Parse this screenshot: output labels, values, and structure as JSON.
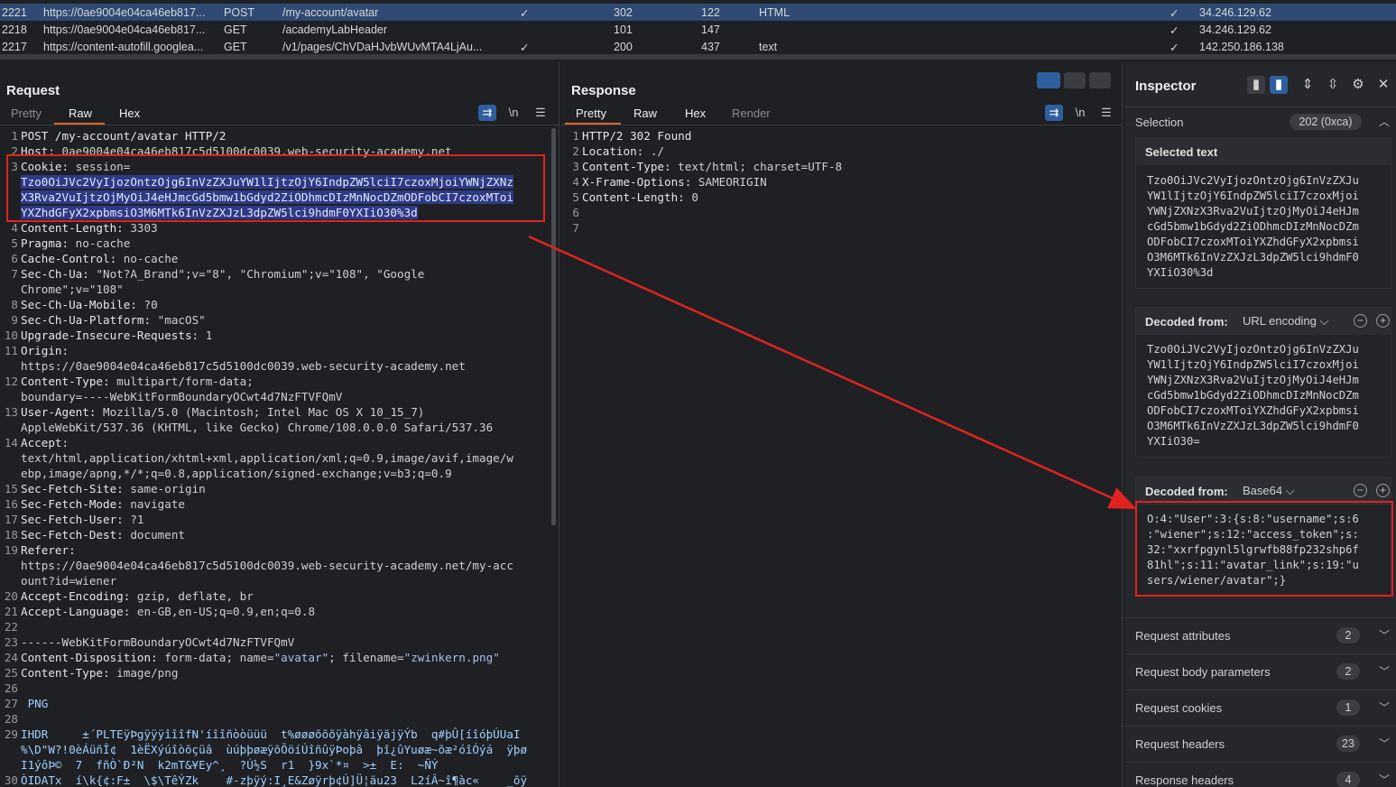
{
  "history": {
    "rows": [
      {
        "id": "2221",
        "url": "https://0ae9004e04ca46eb817...",
        "method": "POST",
        "path": "/my-account/avatar",
        "edited": "✓",
        "status": "302",
        "length": "122",
        "mime": "HTML",
        "tls": "✓",
        "ip": "34.246.129.62"
      },
      {
        "id": "2218",
        "url": "https://0ae9004e04ca46eb817...",
        "method": "GET",
        "path": "/academyLabHeader",
        "edited": "",
        "status": "101",
        "length": "147",
        "mime": "",
        "tls": "✓",
        "ip": "34.246.129.62"
      },
      {
        "id": "2217",
        "url": "https://content-autofill.googlea...",
        "method": "GET",
        "path": "/v1/pages/ChVDaHJvbWUvMTA4LjAu...",
        "edited": "✓",
        "status": "200",
        "length": "437",
        "mime": "text",
        "tls": "✓",
        "ip": "142.250.186.138"
      }
    ]
  },
  "request": {
    "title": "Request",
    "tabs": [
      "Pretty",
      "Raw",
      "Hex"
    ],
    "active_tab": "Raw",
    "tool_newline": "\\n",
    "lines": [
      {
        "n": "1",
        "segs": [
          {
            "t": "POST /my-account/avatar HTTP/2",
            "c": "k"
          }
        ]
      },
      {
        "n": "2",
        "segs": [
          {
            "t": "Host: ",
            "c": "k"
          },
          {
            "t": "0ae9004e04ca46eb817c5d5100dc0039.web-security-academy.net",
            "c": "v"
          }
        ]
      },
      {
        "n": "3",
        "segs": [
          {
            "t": "Cookie: ",
            "c": "k"
          },
          {
            "t": "session=",
            "c": "v"
          }
        ]
      },
      {
        "n": "",
        "segs": [
          {
            "t": "Tzo0OiJVc2VyIjozOntzOjg6InVzZXJuYW1lIjtzOjY6IndpZW5lciI7czoxMjoiYWNjZXNz",
            "c": "hl"
          }
        ]
      },
      {
        "n": "",
        "segs": [
          {
            "t": "X3Rva2VuIjtzOjMyOiJ4eHJmcGd5bmw1bGdyd2ZiODhmcDIzMnNocDZmODFobCI7czoxMToi",
            "c": "hl"
          }
        ]
      },
      {
        "n": "",
        "segs": [
          {
            "t": "YXZhdGFyX2xpbmsiO3M6MTk6InVzZXJzL3dpZW5lci9hdmF0YXIiO30%3d",
            "c": "hl"
          }
        ]
      },
      {
        "n": "4",
        "segs": [
          {
            "t": "Content-Length: ",
            "c": "k"
          },
          {
            "t": "3303",
            "c": "v"
          }
        ]
      },
      {
        "n": "5",
        "segs": [
          {
            "t": "Pragma: ",
            "c": "k"
          },
          {
            "t": "no-cache",
            "c": "v"
          }
        ]
      },
      {
        "n": "6",
        "segs": [
          {
            "t": "Cache-Control: ",
            "c": "k"
          },
          {
            "t": "no-cache",
            "c": "v"
          }
        ]
      },
      {
        "n": "7",
        "segs": [
          {
            "t": "Sec-Ch-Ua: ",
            "c": "k"
          },
          {
            "t": "\"Not?A_Brand\";v=\"8\", \"Chromium\";v=\"108\", \"Google",
            "c": "v"
          }
        ]
      },
      {
        "n": "",
        "segs": [
          {
            "t": "Chrome\";v=\"108\"",
            "c": "v"
          }
        ]
      },
      {
        "n": "8",
        "segs": [
          {
            "t": "Sec-Ch-Ua-Mobile: ",
            "c": "k"
          },
          {
            "t": "?0",
            "c": "v"
          }
        ]
      },
      {
        "n": "9",
        "segs": [
          {
            "t": "Sec-Ch-Ua-Platform: ",
            "c": "k"
          },
          {
            "t": "\"macOS\"",
            "c": "v"
          }
        ]
      },
      {
        "n": "10",
        "segs": [
          {
            "t": "Upgrade-Insecure-Requests: ",
            "c": "k"
          },
          {
            "t": "1",
            "c": "v"
          }
        ]
      },
      {
        "n": "11",
        "segs": [
          {
            "t": "Origin: ",
            "c": "k"
          }
        ]
      },
      {
        "n": "",
        "segs": [
          {
            "t": "https://0ae9004e04ca46eb817c5d5100dc0039.web-security-academy.net",
            "c": "v"
          }
        ]
      },
      {
        "n": "12",
        "segs": [
          {
            "t": "Content-Type: ",
            "c": "k"
          },
          {
            "t": "multipart/form-data;",
            "c": "v"
          }
        ]
      },
      {
        "n": "",
        "segs": [
          {
            "t": "boundary=----WebKitFormBoundaryOCwt4d7NzFTVFQmV",
            "c": "v"
          }
        ]
      },
      {
        "n": "13",
        "segs": [
          {
            "t": "User-Agent: ",
            "c": "k"
          },
          {
            "t": "Mozilla/5.0 (Macintosh; Intel Mac OS X 10_15_7)",
            "c": "v"
          }
        ]
      },
      {
        "n": "",
        "segs": [
          {
            "t": "AppleWebKit/537.36 (KHTML, like Gecko) Chrome/108.0.0.0 Safari/537.36",
            "c": "v"
          }
        ]
      },
      {
        "n": "14",
        "segs": [
          {
            "t": "Accept: ",
            "c": "k"
          }
        ]
      },
      {
        "n": "",
        "segs": [
          {
            "t": "text/html,application/xhtml+xml,application/xml;q=0.9,image/avif,image/w",
            "c": "v"
          }
        ]
      },
      {
        "n": "",
        "segs": [
          {
            "t": "ebp,image/apng,*/*;q=0.8,application/signed-exchange;v=b3;q=0.9",
            "c": "v"
          }
        ]
      },
      {
        "n": "15",
        "segs": [
          {
            "t": "Sec-Fetch-Site: ",
            "c": "k"
          },
          {
            "t": "same-origin",
            "c": "v"
          }
        ]
      },
      {
        "n": "16",
        "segs": [
          {
            "t": "Sec-Fetch-Mode: ",
            "c": "k"
          },
          {
            "t": "navigate",
            "c": "v"
          }
        ]
      },
      {
        "n": "17",
        "segs": [
          {
            "t": "Sec-Fetch-User: ",
            "c": "k"
          },
          {
            "t": "?1",
            "c": "v"
          }
        ]
      },
      {
        "n": "18",
        "segs": [
          {
            "t": "Sec-Fetch-Dest: ",
            "c": "k"
          },
          {
            "t": "document",
            "c": "v"
          }
        ]
      },
      {
        "n": "19",
        "segs": [
          {
            "t": "Referer: ",
            "c": "k"
          }
        ]
      },
      {
        "n": "",
        "segs": [
          {
            "t": "https://0ae9004e04ca46eb817c5d5100dc0039.web-security-academy.net/my-acc",
            "c": "v"
          }
        ]
      },
      {
        "n": "",
        "segs": [
          {
            "t": "ount?id=wiener",
            "c": "v"
          }
        ]
      },
      {
        "n": "20",
        "segs": [
          {
            "t": "Accept-Encoding: ",
            "c": "k"
          },
          {
            "t": "gzip, deflate, br",
            "c": "v"
          }
        ]
      },
      {
        "n": "21",
        "segs": [
          {
            "t": "Accept-Language: ",
            "c": "k"
          },
          {
            "t": "en-GB,en-US;q=0.9,en;q=0.8",
            "c": "v"
          }
        ]
      },
      {
        "n": "22",
        "segs": []
      },
      {
        "n": "23",
        "segs": [
          {
            "t": "------WebKitFormBoundaryOCwt4d7NzFTVFQmV",
            "c": "v"
          }
        ]
      },
      {
        "n": "24",
        "segs": [
          {
            "t": "Content-Disposition: ",
            "c": "k"
          },
          {
            "t": "form-data; name=",
            "c": "v"
          },
          {
            "t": "\"avatar\"",
            "c": "str"
          },
          {
            "t": "; filename=",
            "c": "v"
          },
          {
            "t": "\"zwinkern.png\"",
            "c": "str"
          }
        ]
      },
      {
        "n": "25",
        "segs": [
          {
            "t": "Content-Type: ",
            "c": "k"
          },
          {
            "t": "image/png",
            "c": "v"
          }
        ]
      },
      {
        "n": "26",
        "segs": []
      },
      {
        "n": "27",
        "segs": [
          {
            "t": " PNG",
            "c": "bin"
          }
        ]
      },
      {
        "n": "28",
        "segs": []
      },
      {
        "n": "29",
        "segs": [
          {
            "t": "IHDR     ±´PLTEÿÞgÿÿÿîîîfN'íîîñòòüüü  t%øøøõõõÿàhÿâiÿäjÿÝb  q#þÛ[íîóþÚUaI",
            "c": "bin"
          }
        ]
      },
      {
        "n": "",
        "segs": [
          {
            "t": "%\\D\"W?!0èÁüñÎ¢  1èËXýúîòõçüâ  ùúþþøæÿõÕöíÚîñûÿÞoþâ  þî¿ûYuøæ~õæ²óîÓýá  ÿþø",
            "c": "bin"
          }
        ]
      },
      {
        "n": "",
        "segs": [
          {
            "t": "I1ýôÞ©  7  fñÒ`Ð²N  k2mT&¥Ey^¸  ?Ú½S  r1  }9x`*¤  >±  E:  ~ÑÝ",
            "c": "bin"
          }
        ]
      },
      {
        "n": "30",
        "segs": [
          {
            "t": "ÒIDATx  í\\k{¢:F±  \\$\\TêÝZk    #-zþÿý:I¸E&Zøÿrþ¢Ú]Ü¦äu23  L2íÂ~î¶àc«    _õÿ",
            "c": "bin"
          }
        ]
      }
    ]
  },
  "response": {
    "title": "Response",
    "tabs": [
      "Pretty",
      "Raw",
      "Hex",
      "Render"
    ],
    "active_tab": "Pretty",
    "tool_newline": "\\n",
    "lines": [
      {
        "n": "1",
        "segs": [
          {
            "t": "HTTP/2 302 Found",
            "c": "k"
          }
        ]
      },
      {
        "n": "2",
        "segs": [
          {
            "t": "Location: ",
            "c": "k"
          },
          {
            "t": "./",
            "c": "v"
          }
        ]
      },
      {
        "n": "3",
        "segs": [
          {
            "t": "Content-Type: ",
            "c": "k"
          },
          {
            "t": "text/html; charset=UTF-8",
            "c": "v"
          }
        ]
      },
      {
        "n": "4",
        "segs": [
          {
            "t": "X-Frame-Options: ",
            "c": "k"
          },
          {
            "t": "SAMEORIGIN",
            "c": "v"
          }
        ]
      },
      {
        "n": "5",
        "segs": [
          {
            "t": "Content-Length: ",
            "c": "k"
          },
          {
            "t": "0",
            "c": "v"
          }
        ]
      },
      {
        "n": "6",
        "segs": []
      },
      {
        "n": "7",
        "segs": []
      }
    ]
  },
  "inspector": {
    "title": "Inspector",
    "selection_label": "Selection",
    "selection_value": "202 (0xca)",
    "selected_text_label": "Selected text",
    "selected_text": "Tzo0OiJVc2VyIjozOntzOjg6InVzZXJu\nYW1lIjtzOjY6IndpZW5lciI7czoxMjoi\nYWNjZXNzX3Rva2VuIjtzOjMyOiJ4eHJm\ncGd5bmw1bGdyd2ZiODhmcDIzMnNocDZm\nODFobCI7czoxMToiYXZhdGFyX2xpbmsi\nO3M6MTk6InVzZXJzL3dpZW5lci9hdmF0\nYXIiO30%3d",
    "decoded1_label": "Decoded from:",
    "decoded1_method": "URL encoding",
    "decoded1_text": "Tzo0OiJVc2VyIjozOntzOjg6InVzZXJu\nYW1lIjtzOjY6IndpZW5lciI7czoxMjoi\nYWNjZXNzX3Rva2VuIjtzOjMyOiJ4eHJm\ncGd5bmw1bGdyd2ZiODhmcDIzMnNocDZm\nODFobCI7czoxMToiYXZhdGFyX2xpbmsi\nO3M6MTk6InVzZXJzL3dpZW5lci9hdmF0\nYXIiO30=",
    "decoded2_label": "Decoded from:",
    "decoded2_method": "Base64",
    "decoded2_text": "O:4:\"User\":3:{s:8:\"username\";s:6\n:\"wiener\";s:12:\"access_token\";s:\n32:\"xxrfpgynl5lgrwfb88fp232shp6f\n81hl\";s:11:\"avatar_link\";s:19:\"u\nsers/wiener/avatar\";}",
    "sections": [
      {
        "label": "Request attributes",
        "count": "2"
      },
      {
        "label": "Request body parameters",
        "count": "2"
      },
      {
        "label": "Request cookies",
        "count": "1"
      },
      {
        "label": "Request headers",
        "count": "23"
      },
      {
        "label": "Response headers",
        "count": "4"
      }
    ]
  },
  "colors": {
    "accent_tab": "#e0662b",
    "selected_row": "#2f4a73",
    "highlight": "#2d3a86",
    "annotation_red": "#e0231f"
  }
}
